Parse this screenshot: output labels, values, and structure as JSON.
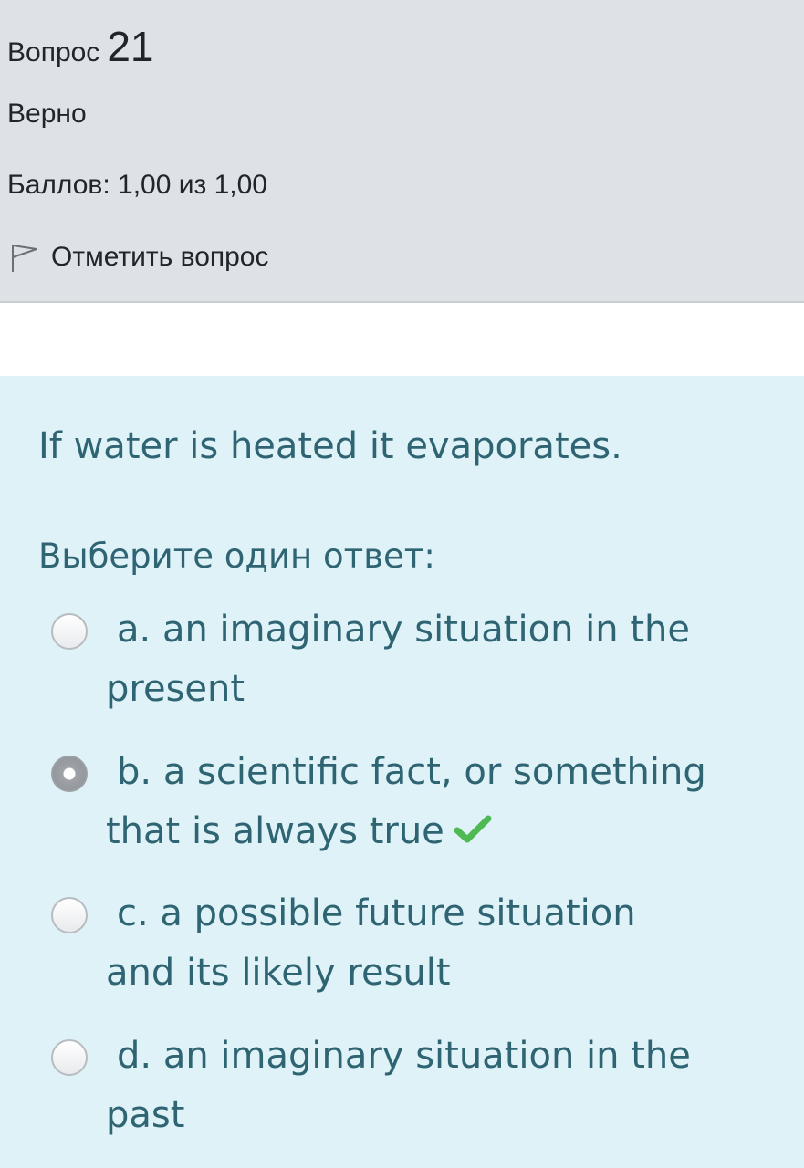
{
  "question": {
    "label": "Вопрос",
    "number": "21",
    "state": "Верно",
    "grade": "Баллов: 1,00 из 1,00",
    "flag_label": "Отметить вопрос",
    "text": "If water is heated it evaporates.",
    "prompt": "Выберите один ответ:"
  },
  "options": [
    {
      "line1": "a. an imaginary situation in the",
      "line2": "present",
      "selected": false,
      "correct": false
    },
    {
      "line1": "b. a scientific fact, or something",
      "line2": "that is always true",
      "selected": true,
      "correct": true
    },
    {
      "line1": "c. a possible future situation",
      "line2": "and its likely result",
      "selected": false,
      "correct": false
    },
    {
      "line1": "d. an imaginary situation in the",
      "line2": "past",
      "selected": false,
      "correct": false
    }
  ],
  "icons": {
    "flag": "flag-outline-icon",
    "correct": "checkmark-icon"
  },
  "colors": {
    "info_bg": "#dee2e6",
    "formulation_bg": "#def2f8",
    "question_text": "#2f6473",
    "check": "#4fb954"
  }
}
